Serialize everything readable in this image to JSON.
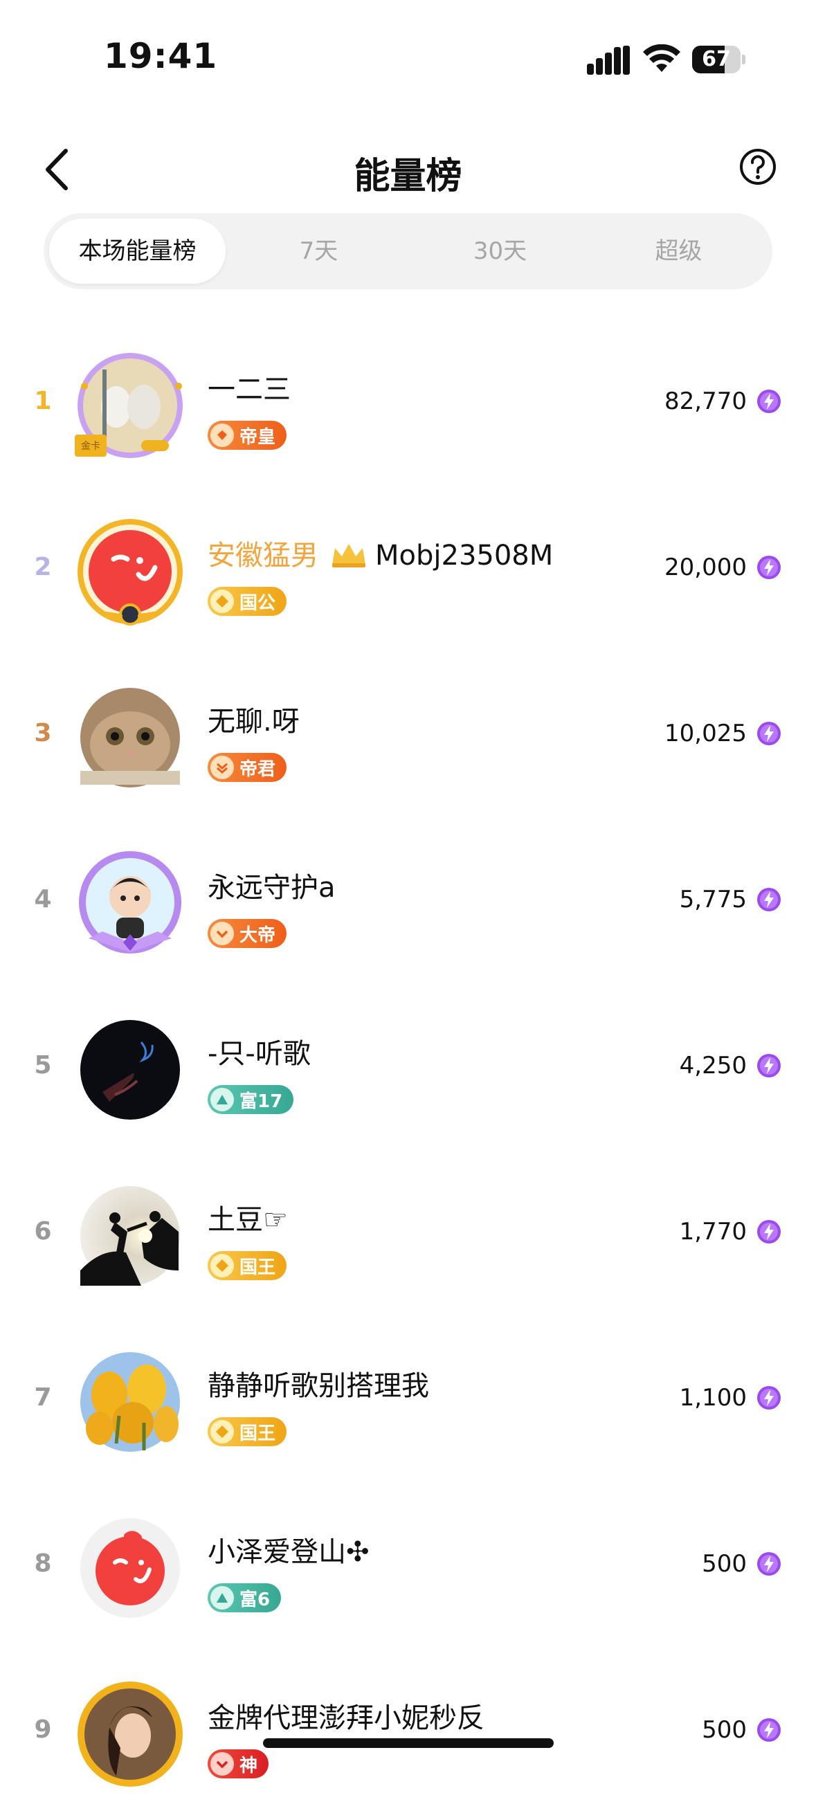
{
  "status": {
    "time": "19:41",
    "battery": "67",
    "battery_level": 0.67
  },
  "nav": {
    "title": "能量榜",
    "back_icon": "chevron-left-icon",
    "help_icon": "question-circle-icon"
  },
  "tabs": [
    {
      "label": "本场能量榜",
      "active": true
    },
    {
      "label": "7天",
      "active": false
    },
    {
      "label": "30天",
      "active": false
    },
    {
      "label": "超级",
      "active": false
    }
  ],
  "colors": {
    "gold": "#f2b52a",
    "silver": "#b7b3e8",
    "bronze": "#d08a4c",
    "energy": "#9b49f0",
    "orange_badge": "#f06a22",
    "gold_badge": "#f0b21e",
    "teal_badge": "#3fb8a4",
    "name_highlight": "#f4a43b"
  },
  "ranks": [
    {
      "rank": "1",
      "name": "一二三",
      "badge": "帝皇",
      "score": "82,770"
    },
    {
      "rank": "2",
      "name": "安徽猛男",
      "name_suffix": "Mobj23508M",
      "badge": "国公",
      "score": "20,000"
    },
    {
      "rank": "3",
      "name": "无聊.呀",
      "badge": "帝君",
      "score": "10,025"
    },
    {
      "rank": "4",
      "name": "永远守护a",
      "badge": "大帝",
      "score": "5,775"
    },
    {
      "rank": "5",
      "name": "-只-听歌",
      "badge": "富17",
      "score": "4,250"
    },
    {
      "rank": "6",
      "name": "土豆☞",
      "badge": "国王",
      "score": "1,770"
    },
    {
      "rank": "7",
      "name": "静静听歌别搭理我",
      "badge": "国王",
      "score": "1,100"
    },
    {
      "rank": "8",
      "name": "小泽爱登山✣",
      "badge": "富6",
      "score": "500"
    },
    {
      "rank": "9",
      "name": "金牌代理澎拜小妮秒反",
      "badge": "神",
      "score": "500"
    }
  ]
}
